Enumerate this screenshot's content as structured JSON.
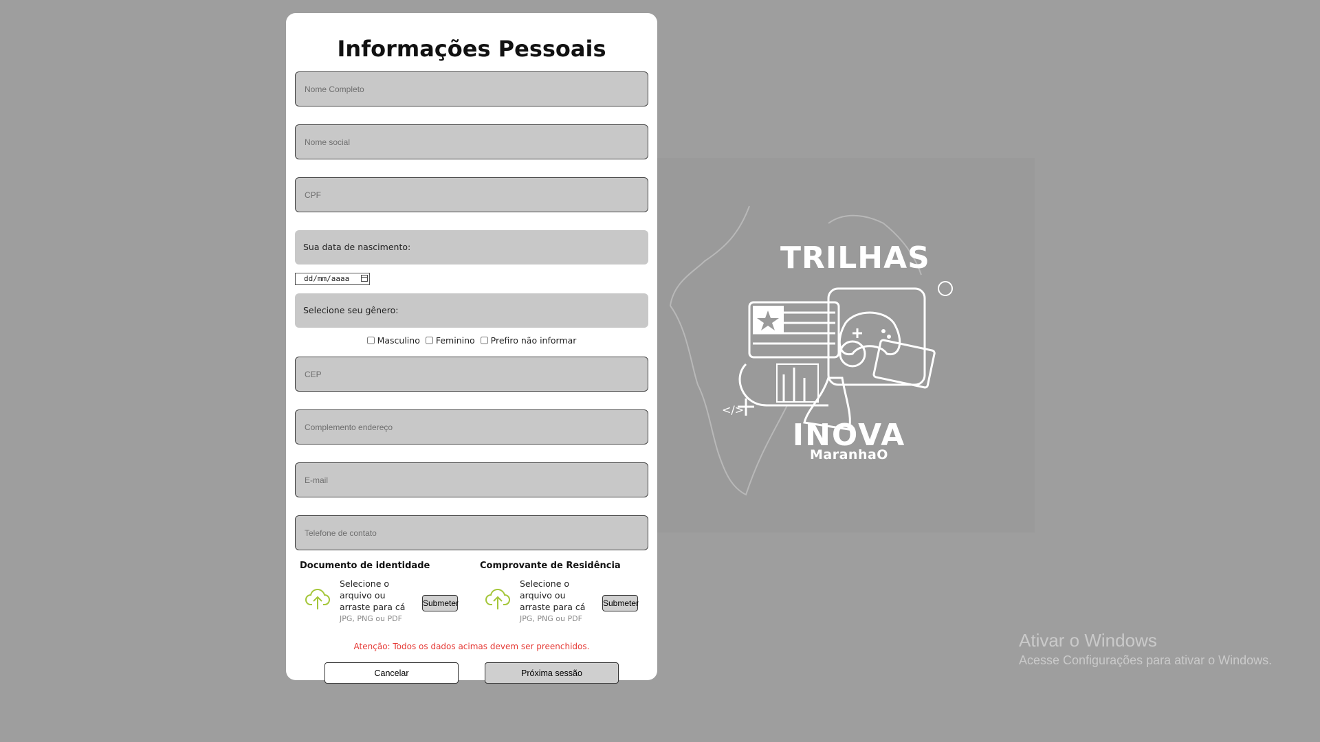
{
  "form": {
    "title": "Informações Pessoais",
    "fields": {
      "nome_completo": "Nome Completo",
      "nome_social": "Nome social",
      "cpf": "CPF",
      "cep": "CEP",
      "complemento": "Complemento endereço",
      "email": "E-mail",
      "telefone": "Telefone de contato"
    },
    "birth_label": "Sua data de nascimento:",
    "date_placeholder": "dd/mm/aaaa",
    "gender_label": "Selecione seu gênero:",
    "gender_options": [
      "Masculino",
      "Feminino",
      "Prefiro não informar"
    ],
    "uploads": [
      {
        "title": "Documento de identidade",
        "text": "Selecione o arquivo ou arraste para cá",
        "hint": "JPG, PNG ou PDF",
        "button": "Submeter"
      },
      {
        "title": "Comprovante de Residência",
        "text": "Selecione o arquivo ou arraste para cá",
        "hint": "JPG, PNG ou PDF",
        "button": "Submeter"
      }
    ],
    "warning": "Atenção: Todos os dados acimas devem ser preenchidos.",
    "cancel_label": "Cancelar",
    "next_label": "Próxima sessão"
  },
  "brand": {
    "top": "TRILHAS",
    "bottom": "INOVA",
    "sub": "MaranhaO"
  },
  "watermark": {
    "line1": "Ativar o Windows",
    "line2": "Acesse Configurações para ativar o Windows."
  },
  "colors": {
    "background": "#9e9e9e",
    "input_bg": "#c8c8c8",
    "warning": "#e53935",
    "upload_icon": "#a4c639"
  }
}
